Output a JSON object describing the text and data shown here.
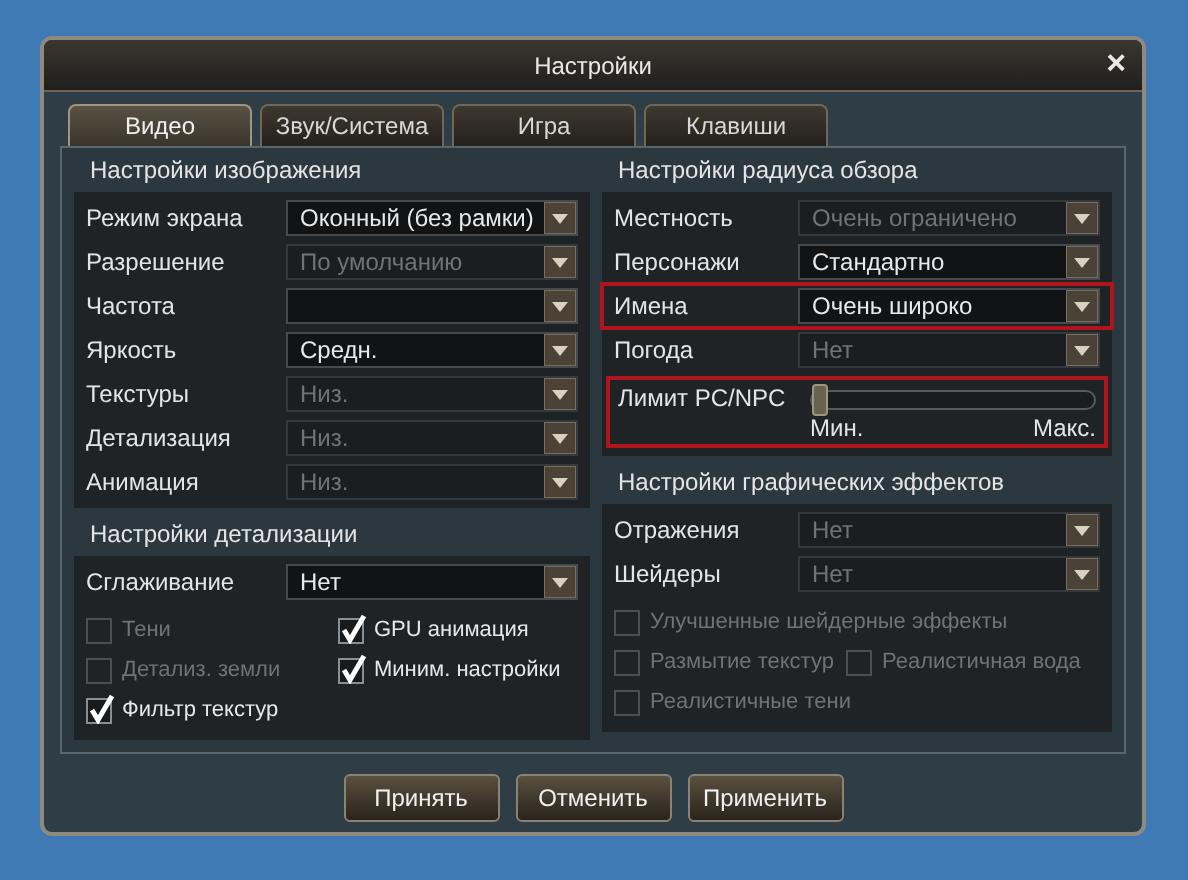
{
  "window": {
    "title": "Настройки",
    "close": "×"
  },
  "tabs": [
    {
      "label": "Видео",
      "selected": true
    },
    {
      "label": "Звук/Система",
      "selected": false
    },
    {
      "label": "Игра",
      "selected": false
    },
    {
      "label": "Клавиши",
      "selected": false
    }
  ],
  "left": [
    {
      "title": "Настройки изображения",
      "items": [
        {
          "kind": "dropdown",
          "label": "Режим экрана",
          "value": "Оконный (без рамки)",
          "disabled": false,
          "highlighted": false
        },
        {
          "kind": "dropdown",
          "label": "Разрешение",
          "value": "По умолчанию",
          "disabled": true,
          "highlighted": false
        },
        {
          "kind": "dropdown",
          "label": "Частота",
          "disabled": false,
          "highlighted": false
        },
        {
          "kind": "dropdown",
          "label": "Яркость",
          "value": "Средн.",
          "disabled": false,
          "highlighted": false
        },
        {
          "kind": "dropdown",
          "label": "Текстуры",
          "value": "Низ.",
          "disabled": true,
          "highlighted": false
        },
        {
          "kind": "dropdown",
          "label": "Детализация",
          "value": "Низ.",
          "disabled": true,
          "highlighted": false
        },
        {
          "kind": "dropdown",
          "label": "Анимация",
          "value": "Низ.",
          "disabled": true,
          "highlighted": false
        }
      ]
    },
    {
      "title": "Настройки детализации",
      "items": [
        {
          "kind": "dropdown",
          "label": "Сглаживание",
          "value": "Нет",
          "disabled": false,
          "highlighted": false
        }
      ],
      "checkbox_rows": [
        [
          {
            "label": "Тени",
            "checked": false,
            "disabled": true
          },
          {
            "label": "GPU анимация",
            "checked": true,
            "disabled": false
          }
        ],
        [
          {
            "label": "Детализ. земли",
            "checked": false,
            "disabled": true
          },
          {
            "label": "Миним. настройки",
            "checked": true,
            "disabled": false
          }
        ],
        [
          {
            "label": "Фильтр текстур",
            "checked": true,
            "disabled": false
          }
        ]
      ]
    }
  ],
  "right": [
    {
      "title": "Настройки радиуса обзора",
      "items": [
        {
          "kind": "dropdown",
          "label": "Местность",
          "value": "Очень ограничено",
          "disabled": true,
          "highlighted": false
        },
        {
          "kind": "dropdown",
          "label": "Персонажи",
          "value": "Стандартно",
          "disabled": false,
          "highlighted": false
        },
        {
          "kind": "dropdown",
          "label": "Имена",
          "value": "Очень широко",
          "disabled": false,
          "highlighted": true
        },
        {
          "kind": "dropdown",
          "label": "Погода",
          "value": "Нет",
          "disabled": true,
          "highlighted": false
        },
        {
          "kind": "slider",
          "label": "Лимит PC/NPC",
          "level": 0,
          "min_label": "Мин.",
          "max_label": "Макс.",
          "highlighted": true
        }
      ]
    },
    {
      "title": "Настройки графических эффектов",
      "items": [
        {
          "kind": "dropdown",
          "label": "Отражения",
          "value": "Нет",
          "disabled": true,
          "highlighted": false
        },
        {
          "kind": "dropdown",
          "label": "Шейдеры",
          "value": "Нет",
          "disabled": true,
          "highlighted": false
        }
      ],
      "checkbox_rows": [
        [
          {
            "label": "Улучшенные шейдерные эффекты",
            "checked": false,
            "disabled": true
          }
        ],
        [
          {
            "label": "Размытие текстур",
            "checked": false,
            "disabled": true
          },
          {
            "label": "Реалистичная вода",
            "checked": false,
            "disabled": true
          }
        ],
        [
          {
            "label": "Реалистичные тени",
            "checked": false,
            "disabled": true
          }
        ]
      ]
    }
  ],
  "buttons": [
    "Принять",
    "Отменить",
    "Применить"
  ]
}
